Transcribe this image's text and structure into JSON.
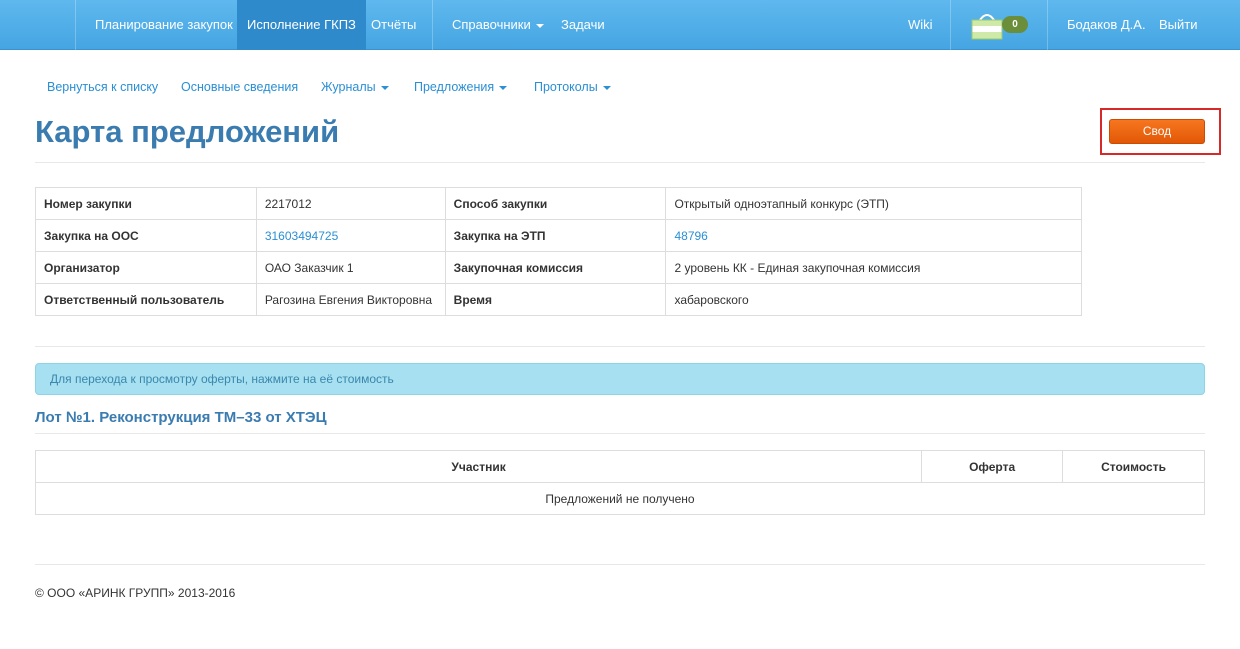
{
  "navbar": {
    "items": [
      {
        "label": "Планирование закупок"
      },
      {
        "label": "Исполнение ГКПЗ"
      },
      {
        "label": "Отчёты"
      },
      {
        "label": "Справочники"
      },
      {
        "label": "Задачи"
      }
    ],
    "wiki": "Wiki",
    "cart_count": "0",
    "user": "Бодаков Д.А.",
    "logout": "Выйти"
  },
  "subnav": {
    "items": [
      {
        "label": "Вернуться к списку"
      },
      {
        "label": "Основные сведения"
      },
      {
        "label": "Журналы"
      },
      {
        "label": "Предложения"
      },
      {
        "label": "Протоколы"
      }
    ]
  },
  "page": {
    "title": "Карта предложений",
    "svod_button": "Свод"
  },
  "info": {
    "rows": [
      {
        "l1": "Номер закупки",
        "v1": "2217012",
        "l2": "Способ закупки",
        "v2": "Открытый одноэтапный конкурс (ЭТП)"
      },
      {
        "l1": "Закупка на ООС",
        "v1": "31603494725",
        "l2": "Закупка на ЭТП",
        "v2": "48796"
      },
      {
        "l1": "Организатор",
        "v1": "ОАО Заказчик 1",
        "l2": "Закупочная комиссия",
        "v2": "2 уровень КК - Единая закупочная комиссия"
      },
      {
        "l1": "Ответственный пользователь",
        "v1": "Рагозина Евгения Викторовна",
        "l2": "Время",
        "v2": "хабаровского"
      }
    ]
  },
  "alert": "Для перехода к просмотру оферты, нажмите на её стоимость",
  "lot": {
    "title": "Лот №1. Реконструкция ТМ–33 от ХТЭЦ",
    "columns": [
      "Участник",
      "Оферта",
      "Стоимость"
    ],
    "empty": "Предложений не получено"
  },
  "footer": "© ООО «АРИНК ГРУПП» 2013-2016",
  "colors": {
    "navbar": "#4aa9e5",
    "accent_orange": "#e85f0a",
    "title_blue": "#3a7bb0",
    "link_blue": "#2a8fd4",
    "alert_bg": "#a7e0f0",
    "highlight_red": "#d62a2a"
  }
}
